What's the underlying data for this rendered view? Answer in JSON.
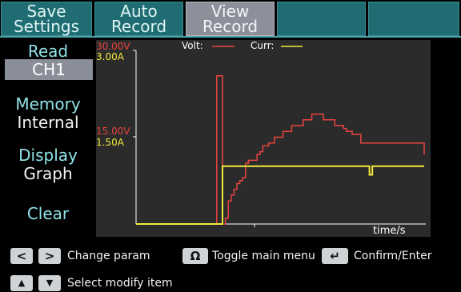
{
  "tabs": [
    {
      "line1": "Save",
      "line2": "Settings"
    },
    {
      "line1": "Auto",
      "line2": "Record"
    },
    {
      "line1": "View",
      "line2": "Record"
    },
    {
      "line1": "",
      "line2": ""
    },
    {
      "line1": "",
      "line2": ""
    }
  ],
  "menu": {
    "read_label": "Read",
    "read_value": "CH1",
    "memory_label": "Memory",
    "memory_value": "Internal",
    "display_label": "Display",
    "display_value": "Graph",
    "clear_label": "Clear"
  },
  "graph": {
    "v_max_label": "30.00V",
    "a_max_label": "3.00A",
    "v_mid_label": "15.00V",
    "a_mid_label": "1.50A",
    "legend_volt": "Volt:",
    "legend_curr": "Curr:",
    "x_label": "time/s",
    "colors": {
      "volt": "#e8443f",
      "curr": "#f2ea3c",
      "axis": "#ffffff",
      "background": "#2b2b2b"
    }
  },
  "chart_data": {
    "type": "line",
    "xlabel": "time/s",
    "ylim_volt": [
      0,
      30
    ],
    "ylim_curr": [
      0,
      3
    ],
    "series": [
      {
        "name": "Volt:",
        "x": [
          0,
          26,
          27,
          28,
          28.5,
          29,
          29.5,
          30,
          31,
          32,
          33,
          34,
          35,
          36,
          37,
          38,
          39,
          40,
          41,
          42,
          43,
          44,
          45,
          46,
          47,
          48,
          49,
          50,
          51,
          52,
          53,
          54,
          55,
          56,
          57,
          58,
          59,
          60,
          61,
          62,
          63,
          64,
          65,
          66,
          67,
          68,
          69,
          70,
          71,
          72,
          73,
          74,
          75,
          76,
          77,
          78,
          79,
          80,
          81,
          82,
          83,
          84,
          85,
          86,
          87,
          88,
          89,
          90,
          91,
          92,
          93,
          94,
          95,
          96,
          97,
          98,
          99,
          100
        ],
        "y": [
          0,
          0,
          0,
          25.6,
          25.6,
          25.6,
          25.6,
          0,
          1,
          4,
          5,
          6,
          7,
          7.5,
          8,
          10.5,
          11,
          11,
          11,
          12,
          12.5,
          13.5,
          13.5,
          14,
          14,
          15,
          15,
          15,
          16,
          16,
          16,
          17,
          17,
          17,
          17,
          18,
          18,
          18,
          19,
          19,
          19,
          19,
          18,
          18,
          18,
          18,
          17,
          17,
          17,
          16.5,
          16,
          16,
          15.5,
          15.5,
          15.5,
          14,
          14,
          14,
          14,
          14,
          14,
          14,
          14,
          14,
          14,
          14,
          14,
          14,
          14,
          14,
          14,
          14,
          14,
          14,
          14,
          14,
          14,
          12
        ]
      },
      {
        "name": "Curr:",
        "x": [
          0,
          29.5,
          30,
          80,
          81,
          82,
          84,
          100
        ],
        "y": [
          0,
          0,
          1.0,
          1.0,
          0.85,
          1.0,
          1.0,
          1.0
        ]
      }
    ]
  },
  "hints": {
    "left_key": "<",
    "right_key": ">",
    "change_param": "Change param",
    "toggle_icon": "Ω",
    "toggle_label": "Toggle main menu",
    "enter_icon": "↵",
    "confirm_label": "Confirm/Enter",
    "up_key": "▲",
    "down_key": "▼",
    "select_label": "Select modify item"
  }
}
